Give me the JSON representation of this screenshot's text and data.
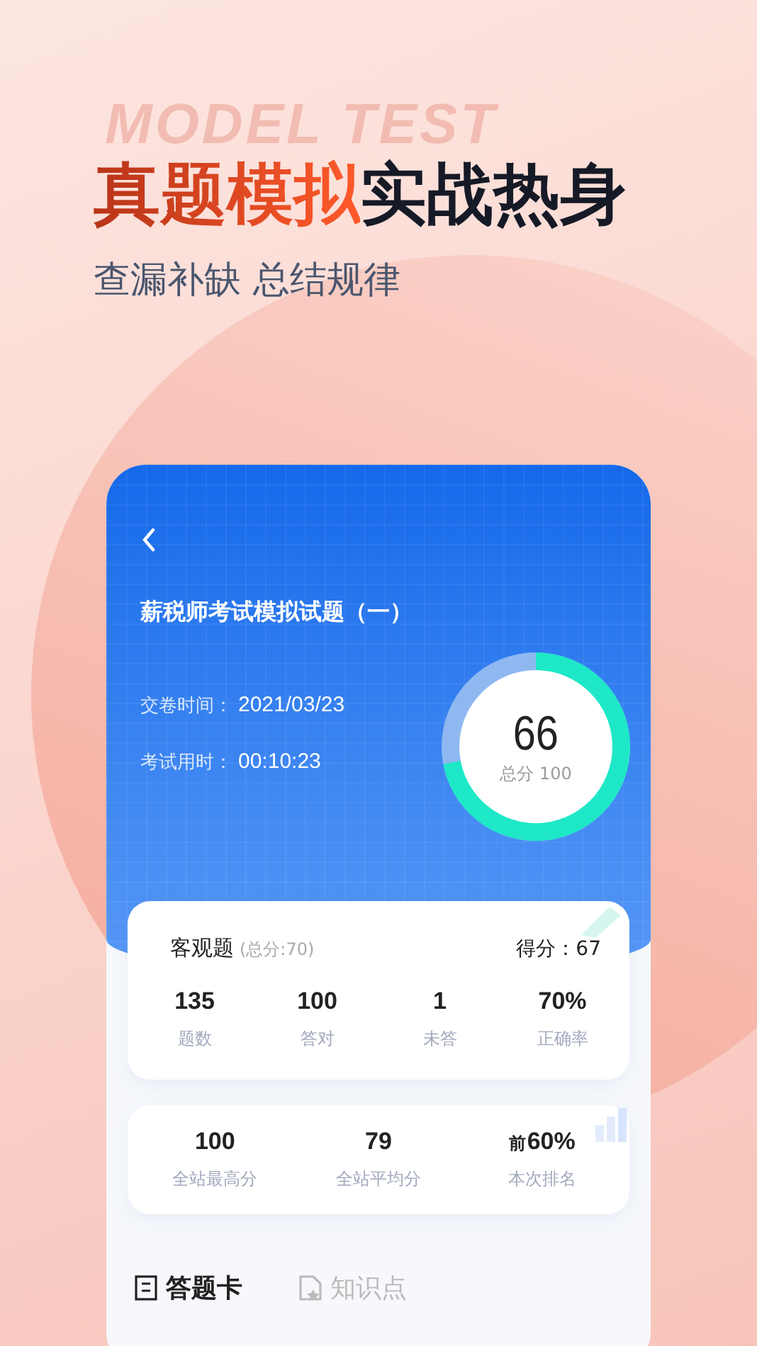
{
  "hero": {
    "watermark": "MODEL TEST",
    "headline_accent": "真题模拟",
    "headline_rest": "实战热身",
    "subtitle": "查漏补缺 总结规律"
  },
  "report": {
    "title": "薪税师考试模拟试题（一）",
    "info": [
      {
        "label": "交卷时间：",
        "value": "2021/03/23"
      },
      {
        "label": "考试用时：",
        "value": "00:10:23"
      }
    ],
    "score": {
      "value": "66",
      "caption": "总分 100",
      "level": 0.72
    }
  },
  "objective": {
    "title": "客观题",
    "subtitle": "(总分:70)",
    "score_label": "得分：",
    "score": "67",
    "stats": [
      {
        "value": "135",
        "label": "题数"
      },
      {
        "value": "100",
        "label": "答对"
      },
      {
        "value": "1",
        "label": "未答"
      },
      {
        "value": "70%",
        "label": "正确率"
      }
    ]
  },
  "ranking": [
    {
      "value": "100",
      "label": "全站最高分"
    },
    {
      "value": "79",
      "label": "全站平均分"
    },
    {
      "prefix": "前",
      "value": "60%",
      "label": "本次排名"
    }
  ],
  "tabs": [
    {
      "label": "答题卡",
      "selected": true,
      "kind": "card"
    },
    {
      "label": "知识点",
      "selected": false,
      "kind": "doc"
    }
  ]
}
